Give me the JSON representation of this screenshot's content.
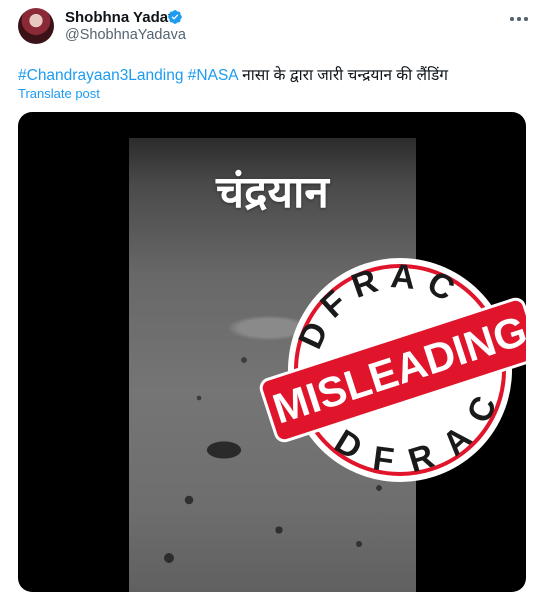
{
  "author": {
    "name": "Shobhna Yadav",
    "handle": "@ShobhnaYadava"
  },
  "tweet": {
    "hashtags": [
      "#Chandrayaan3Landing",
      "#NASA"
    ],
    "text": "नासा के द्वारा जारी चन्द्रयान की लैंडिंग",
    "translate_label": "Translate post"
  },
  "media": {
    "video_overlay_text": "चंद्रयान",
    "stamp": {
      "top_text": "DFRAC",
      "bottom_text": "DFRAC",
      "banner_text": "MISLEADING",
      "color": "#e0152b"
    }
  },
  "icons": {
    "verified": "verified-badge-icon",
    "more": "more-options-icon"
  },
  "colors": {
    "accent": "#1d9bf0",
    "text": "#0f1419",
    "muted": "#536471"
  }
}
